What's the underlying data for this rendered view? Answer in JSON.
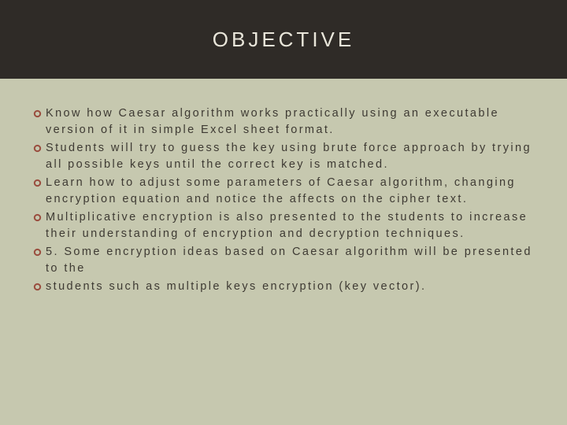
{
  "slide": {
    "title": "OBJECTIVE",
    "bullets": [
      "Know how Caesar algorithm works practically using an executable version of it in simple Excel sheet format.",
      "Students will try to guess the key using brute force approach by trying all possible keys until the correct key is matched.",
      "Learn how to adjust some parameters of Caesar algorithm, changing encryption equation and notice the affects on the cipher text.",
      "Multiplicative encryption is also presented to the students to increase their understanding of encryption and decryption techniques.",
      "5. Some encryption ideas based on Caesar algorithm will be presented to the",
      "students such as multiple keys encryption (key vector)."
    ]
  }
}
